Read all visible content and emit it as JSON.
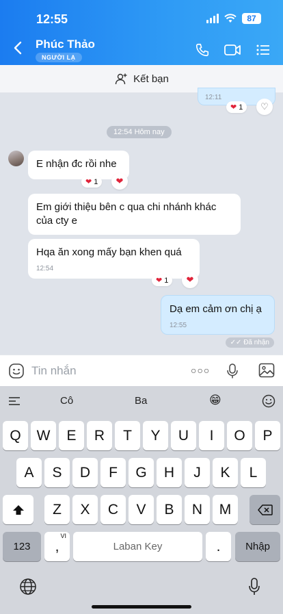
{
  "status": {
    "time": "12:55",
    "battery": "87"
  },
  "header": {
    "title": "Phúc Thảo",
    "badge": "NGƯỜI LẠ"
  },
  "add_friend": {
    "label": "Kết bạn"
  },
  "chat": {
    "top_partial_time": "12:11",
    "top_partial_react_count": "1",
    "date_chip": "12:54 Hôm nay",
    "messages": [
      {
        "text": "E nhận đc rồi nhe",
        "react_count": "1"
      },
      {
        "text": "Em giới thiệu bên c qua chi nhánh khác của cty e"
      },
      {
        "text": "Hqa ăn xong mấy bạn khen quá",
        "time": "12:54",
        "react_count": "1"
      },
      {
        "text": "Dạ em cảm ơn chị ạ",
        "time": "12:55"
      }
    ],
    "seen": "Đã nhận"
  },
  "input": {
    "placeholder": "Tin nhắn"
  },
  "keyboard": {
    "suggestions": [
      "Cô",
      "Ba",
      "😁"
    ],
    "row1": [
      "Q",
      "W",
      "E",
      "R",
      "T",
      "Y",
      "U",
      "I",
      "O",
      "P"
    ],
    "row2": [
      "A",
      "S",
      "D",
      "F",
      "G",
      "H",
      "J",
      "K",
      "L"
    ],
    "row3": [
      "Z",
      "X",
      "C",
      "V",
      "B",
      "N",
      "M"
    ],
    "num_key": "123",
    "comma_key": ",",
    "vi_label": "VI",
    "space_label": "Laban Key",
    "dot_key": ".",
    "enter_key": "Nhập"
  },
  "colors": {
    "header": "#1b7cf0",
    "outgoing": "#d4ecff",
    "heart": "#e0243a"
  }
}
